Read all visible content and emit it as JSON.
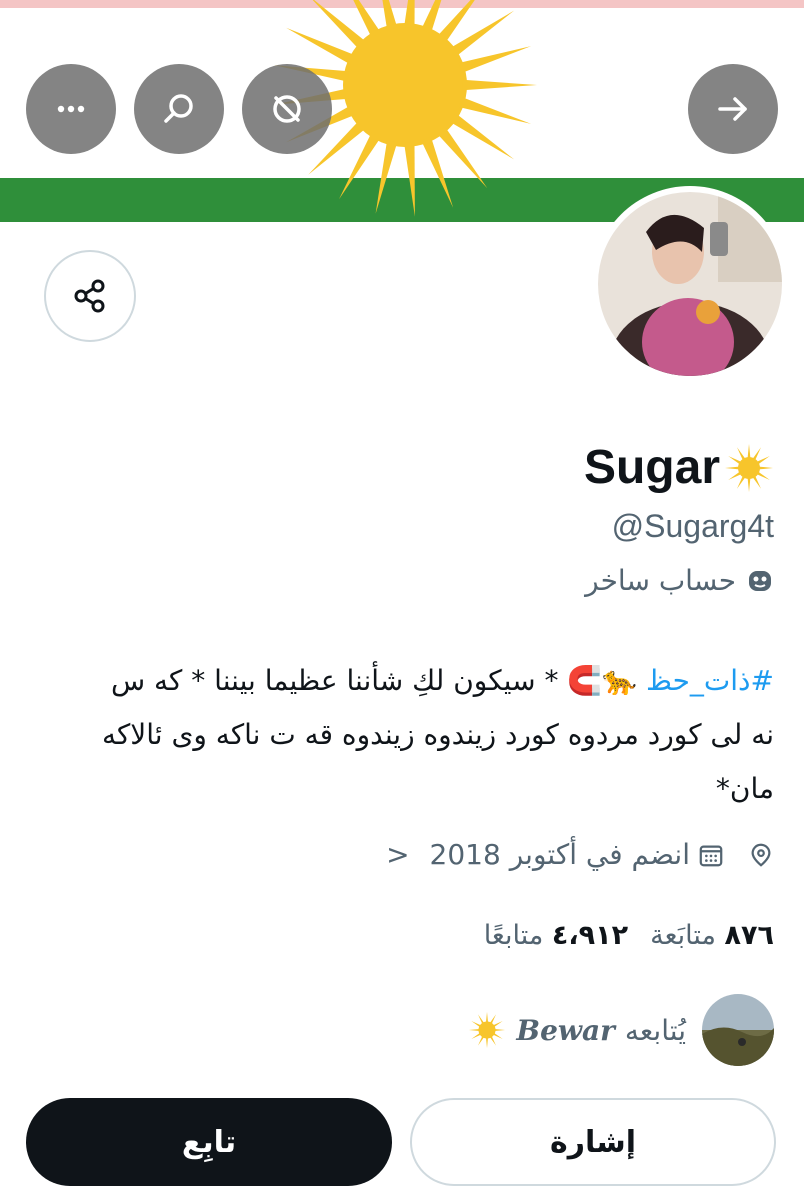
{
  "profile": {
    "display_name": "Sugar",
    "handle": "@Sugarg4t",
    "account_label": "حساب ساخر",
    "bio": {
      "hashtag": "#ذات_حظ",
      "emojis": "🐆🧲",
      "line1_rest": " * سيكون لكِ شأننا عظيما بيننا * كه س",
      "line2": "نه لى كورد مردوه كورد زيندوه زيندوه قه ت ناكه وى ئالاكه",
      "line3": "مان*"
    },
    "location_icon": "location-pin-icon",
    "joined": "انضم في أكتوبر 2018",
    "joined_chevron": "<",
    "following_count": "٨٧٦",
    "following_label": "متابَعة",
    "followers_count": "٤،٩١٢",
    "followers_label": "متابعًا"
  },
  "followed_by": {
    "prefix": "يُتابعه",
    "name": "Bewar"
  },
  "actions": {
    "follow_label": "تابِع",
    "mention_label": "إشارة"
  },
  "icons": {
    "more": "more-horizontal-icon",
    "search": "search-icon",
    "grok": "grok-icon",
    "forward": "arrow-right-icon",
    "share": "share-icon",
    "calendar": "calendar-icon",
    "mask": "mask-icon"
  },
  "colors": {
    "accent": "#1d9bf0",
    "banner_green": "#2f8f3a",
    "sun_yellow": "#f7c52b",
    "text_primary": "#0f1419",
    "text_secondary": "#536471"
  }
}
